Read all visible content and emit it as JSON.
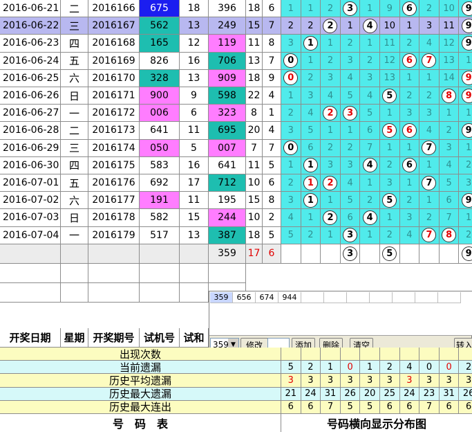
{
  "rows": [
    {
      "date": "2016-06-21",
      "weekday": "二",
      "period": "2016166",
      "trial": "675",
      "tail": "18",
      "draw": "396",
      "sum": "18",
      "span": "6",
      "selected": false,
      "trialColor": "blue",
      "drawColor": "none",
      "dist": [
        {
          "v": "1",
          "c": ""
        },
        {
          "v": "1",
          "c": ""
        },
        {
          "v": "2",
          "c": ""
        },
        {
          "v": "3",
          "c": "blk"
        },
        {
          "v": "1",
          "c": ""
        },
        {
          "v": "9",
          "c": ""
        },
        {
          "v": "6",
          "c": "blk"
        },
        {
          "v": "2",
          "c": ""
        },
        {
          "v": "10",
          "c": ""
        },
        {
          "v": "9",
          "c": "blk"
        }
      ]
    },
    {
      "date": "2016-06-22",
      "weekday": "三",
      "period": "2016167",
      "trial": "562",
      "tail": "13",
      "draw": "249",
      "sum": "15",
      "span": "7",
      "selected": true,
      "trialColor": "teal",
      "drawColor": "none",
      "dist": [
        {
          "v": "2",
          "c": ""
        },
        {
          "v": "2",
          "c": ""
        },
        {
          "v": "2",
          "c": "blk"
        },
        {
          "v": "1",
          "c": ""
        },
        {
          "v": "4",
          "c": "blk"
        },
        {
          "v": "10",
          "c": ""
        },
        {
          "v": "1",
          "c": ""
        },
        {
          "v": "3",
          "c": ""
        },
        {
          "v": "11",
          "c": ""
        },
        {
          "v": "9",
          "c": "blk"
        }
      ]
    },
    {
      "date": "2016-06-23",
      "weekday": "四",
      "period": "2016168",
      "trial": "165",
      "tail": "12",
      "draw": "119",
      "sum": "11",
      "span": "8",
      "selected": false,
      "trialColor": "teal",
      "drawColor": "pink",
      "dist": [
        {
          "v": "3",
          "c": ""
        },
        {
          "v": "1",
          "c": "blk"
        },
        {
          "v": "1",
          "c": ""
        },
        {
          "v": "2",
          "c": ""
        },
        {
          "v": "1",
          "c": ""
        },
        {
          "v": "11",
          "c": ""
        },
        {
          "v": "2",
          "c": ""
        },
        {
          "v": "4",
          "c": ""
        },
        {
          "v": "12",
          "c": ""
        },
        {
          "v": "9",
          "c": "blk"
        }
      ]
    },
    {
      "date": "2016-06-24",
      "weekday": "五",
      "period": "2016169",
      "trial": "826",
      "tail": "16",
      "draw": "706",
      "sum": "13",
      "span": "7",
      "selected": false,
      "trialColor": "none",
      "drawColor": "teal",
      "dist": [
        {
          "v": "0",
          "c": "blk"
        },
        {
          "v": "1",
          "c": ""
        },
        {
          "v": "2",
          "c": ""
        },
        {
          "v": "3",
          "c": ""
        },
        {
          "v": "2",
          "c": ""
        },
        {
          "v": "12",
          "c": ""
        },
        {
          "v": "6",
          "c": "red"
        },
        {
          "v": "7",
          "c": "red"
        },
        {
          "v": "13",
          "c": ""
        },
        {
          "v": "1",
          "c": ""
        }
      ]
    },
    {
      "date": "2016-06-25",
      "weekday": "六",
      "period": "2016170",
      "trial": "328",
      "tail": "13",
      "draw": "909",
      "sum": "18",
      "span": "9",
      "selected": false,
      "trialColor": "teal",
      "drawColor": "pink",
      "dist": [
        {
          "v": "0",
          "c": "red"
        },
        {
          "v": "2",
          "c": ""
        },
        {
          "v": "3",
          "c": ""
        },
        {
          "v": "4",
          "c": ""
        },
        {
          "v": "3",
          "c": ""
        },
        {
          "v": "13",
          "c": ""
        },
        {
          "v": "1",
          "c": ""
        },
        {
          "v": "1",
          "c": ""
        },
        {
          "v": "14",
          "c": ""
        },
        {
          "v": "9",
          "c": "red"
        }
      ]
    },
    {
      "date": "2016-06-26",
      "weekday": "日",
      "period": "2016171",
      "trial": "900",
      "tail": "9",
      "draw": "598",
      "sum": "22",
      "span": "4",
      "selected": false,
      "trialColor": "pink",
      "drawColor": "teal",
      "dist": [
        {
          "v": "1",
          "c": ""
        },
        {
          "v": "3",
          "c": ""
        },
        {
          "v": "4",
          "c": ""
        },
        {
          "v": "5",
          "c": ""
        },
        {
          "v": "4",
          "c": ""
        },
        {
          "v": "5",
          "c": "blk"
        },
        {
          "v": "2",
          "c": ""
        },
        {
          "v": "2",
          "c": ""
        },
        {
          "v": "8",
          "c": "red"
        },
        {
          "v": "9",
          "c": "red"
        }
      ]
    },
    {
      "date": "2016-06-27",
      "weekday": "一",
      "period": "2016172",
      "trial": "006",
      "tail": "6",
      "draw": "323",
      "sum": "8",
      "span": "1",
      "selected": false,
      "trialColor": "pink",
      "drawColor": "pink",
      "dist": [
        {
          "v": "2",
          "c": ""
        },
        {
          "v": "4",
          "c": ""
        },
        {
          "v": "2",
          "c": "red"
        },
        {
          "v": "3",
          "c": "red"
        },
        {
          "v": "5",
          "c": ""
        },
        {
          "v": "1",
          "c": ""
        },
        {
          "v": "3",
          "c": ""
        },
        {
          "v": "3",
          "c": ""
        },
        {
          "v": "1",
          "c": ""
        },
        {
          "v": "1",
          "c": ""
        }
      ]
    },
    {
      "date": "2016-06-28",
      "weekday": "二",
      "period": "2016173",
      "trial": "641",
      "tail": "11",
      "draw": "695",
      "sum": "20",
      "span": "4",
      "selected": false,
      "trialColor": "none",
      "drawColor": "teal",
      "dist": [
        {
          "v": "3",
          "c": ""
        },
        {
          "v": "5",
          "c": ""
        },
        {
          "v": "1",
          "c": ""
        },
        {
          "v": "1",
          "c": ""
        },
        {
          "v": "6",
          "c": ""
        },
        {
          "v": "5",
          "c": "red"
        },
        {
          "v": "6",
          "c": "red"
        },
        {
          "v": "4",
          "c": ""
        },
        {
          "v": "2",
          "c": ""
        },
        {
          "v": "9",
          "c": "blk"
        }
      ]
    },
    {
      "date": "2016-06-29",
      "weekday": "三",
      "period": "2016174",
      "trial": "050",
      "tail": "5",
      "draw": "007",
      "sum": "7",
      "span": "7",
      "selected": false,
      "trialColor": "pink",
      "drawColor": "pink",
      "dist": [
        {
          "v": "0",
          "c": "blk"
        },
        {
          "v": "6",
          "c": ""
        },
        {
          "v": "2",
          "c": ""
        },
        {
          "v": "2",
          "c": ""
        },
        {
          "v": "7",
          "c": ""
        },
        {
          "v": "1",
          "c": ""
        },
        {
          "v": "1",
          "c": ""
        },
        {
          "v": "7",
          "c": "blk"
        },
        {
          "v": "3",
          "c": ""
        },
        {
          "v": "1",
          "c": ""
        }
      ]
    },
    {
      "date": "2016-06-30",
      "weekday": "四",
      "period": "2016175",
      "trial": "583",
      "tail": "16",
      "draw": "641",
      "sum": "11",
      "span": "5",
      "selected": false,
      "trialColor": "none",
      "drawColor": "none",
      "dist": [
        {
          "v": "1",
          "c": ""
        },
        {
          "v": "1",
          "c": "blk"
        },
        {
          "v": "3",
          "c": ""
        },
        {
          "v": "3",
          "c": ""
        },
        {
          "v": "4",
          "c": "blk"
        },
        {
          "v": "2",
          "c": ""
        },
        {
          "v": "6",
          "c": "blk"
        },
        {
          "v": "1",
          "c": ""
        },
        {
          "v": "4",
          "c": ""
        },
        {
          "v": "2",
          "c": ""
        }
      ]
    },
    {
      "date": "2016-07-01",
      "weekday": "五",
      "period": "2016176",
      "trial": "692",
      "tail": "17",
      "draw": "712",
      "sum": "10",
      "span": "6",
      "selected": false,
      "trialColor": "none",
      "drawColor": "teal",
      "dist": [
        {
          "v": "2",
          "c": ""
        },
        {
          "v": "1",
          "c": "red"
        },
        {
          "v": "2",
          "c": "red"
        },
        {
          "v": "4",
          "c": ""
        },
        {
          "v": "1",
          "c": ""
        },
        {
          "v": "3",
          "c": ""
        },
        {
          "v": "1",
          "c": ""
        },
        {
          "v": "7",
          "c": "blk"
        },
        {
          "v": "5",
          "c": ""
        },
        {
          "v": "3",
          "c": ""
        }
      ]
    },
    {
      "date": "2016-07-02",
      "weekday": "六",
      "period": "2016177",
      "trial": "191",
      "tail": "11",
      "draw": "195",
      "sum": "15",
      "span": "8",
      "selected": false,
      "trialColor": "pink",
      "drawColor": "none",
      "dist": [
        {
          "v": "3",
          "c": ""
        },
        {
          "v": "1",
          "c": "blk"
        },
        {
          "v": "1",
          "c": ""
        },
        {
          "v": "5",
          "c": ""
        },
        {
          "v": "2",
          "c": ""
        },
        {
          "v": "5",
          "c": "blk"
        },
        {
          "v": "2",
          "c": ""
        },
        {
          "v": "1",
          "c": ""
        },
        {
          "v": "6",
          "c": ""
        },
        {
          "v": "9",
          "c": "blk"
        }
      ]
    },
    {
      "date": "2016-07-03",
      "weekday": "日",
      "period": "2016178",
      "trial": "582",
      "tail": "15",
      "draw": "244",
      "sum": "10",
      "span": "2",
      "selected": false,
      "trialColor": "none",
      "drawColor": "pink",
      "dist": [
        {
          "v": "4",
          "c": ""
        },
        {
          "v": "1",
          "c": ""
        },
        {
          "v": "2",
          "c": "blk"
        },
        {
          "v": "6",
          "c": ""
        },
        {
          "v": "4",
          "c": "blk"
        },
        {
          "v": "1",
          "c": ""
        },
        {
          "v": "3",
          "c": ""
        },
        {
          "v": "2",
          "c": ""
        },
        {
          "v": "7",
          "c": ""
        },
        {
          "v": "1",
          "c": ""
        }
      ]
    },
    {
      "date": "2016-07-04",
      "weekday": "一",
      "period": "2016179",
      "trial": "517",
      "tail": "13",
      "draw": "387",
      "sum": "18",
      "span": "5",
      "selected": false,
      "trialColor": "none",
      "drawColor": "teal",
      "dist": [
        {
          "v": "5",
          "c": ""
        },
        {
          "v": "2",
          "c": ""
        },
        {
          "v": "1",
          "c": ""
        },
        {
          "v": "3",
          "c": "blk"
        },
        {
          "v": "1",
          "c": ""
        },
        {
          "v": "2",
          "c": ""
        },
        {
          "v": "4",
          "c": ""
        },
        {
          "v": "7",
          "c": "red"
        },
        {
          "v": "8",
          "c": "red"
        },
        {
          "v": "2",
          "c": ""
        }
      ]
    }
  ],
  "forecast": {
    "draw": "359",
    "sum": "17",
    "span": "6",
    "circled": [
      "3",
      "5",
      "9"
    ]
  },
  "headers": {
    "date": "开奖日期",
    "weekday": "星期",
    "period": "开奖期号",
    "trial": "试机号",
    "tail": "试和"
  },
  "panel": {
    "tabs": [
      "359",
      "656",
      "674",
      "944"
    ],
    "select_value": "359",
    "modify_button": "修改",
    "add_button": "添加",
    "delete_button": "删除",
    "clear_button": "清空",
    "transfer_button": "转入"
  },
  "stats": [
    {
      "label": "出现次数",
      "values": [
        "",
        "",
        "",
        "",
        "",
        "",
        "",
        "",
        "",
        ""
      ]
    },
    {
      "label": "当前遗漏",
      "values": [
        "5",
        "2",
        "1",
        "0",
        "1",
        "2",
        "4",
        "0",
        "0",
        "2"
      ],
      "red": [
        3,
        8
      ]
    },
    {
      "label": "历史平均遗漏",
      "values": [
        "3",
        "3",
        "3",
        "3",
        "3",
        "3",
        "3",
        "3",
        "3",
        "3"
      ],
      "red": [
        0,
        6
      ]
    },
    {
      "label": "历史最大遗漏",
      "values": [
        "21",
        "24",
        "31",
        "26",
        "20",
        "25",
        "24",
        "23",
        "31",
        "26"
      ]
    },
    {
      "label": "历史最大连出",
      "values": [
        "6",
        "6",
        "7",
        "5",
        "5",
        "6",
        "6",
        "7",
        "6",
        "6"
      ]
    }
  ],
  "footer": {
    "left": "号　码　表",
    "right": "号码横向显示分布图"
  },
  "colors": {
    "teal": "#1ebeb0",
    "blue": "#1b1ef0",
    "pink": "#ff7dff",
    "selected": "#b8b8f0",
    "cyan": "#50ebeb"
  }
}
